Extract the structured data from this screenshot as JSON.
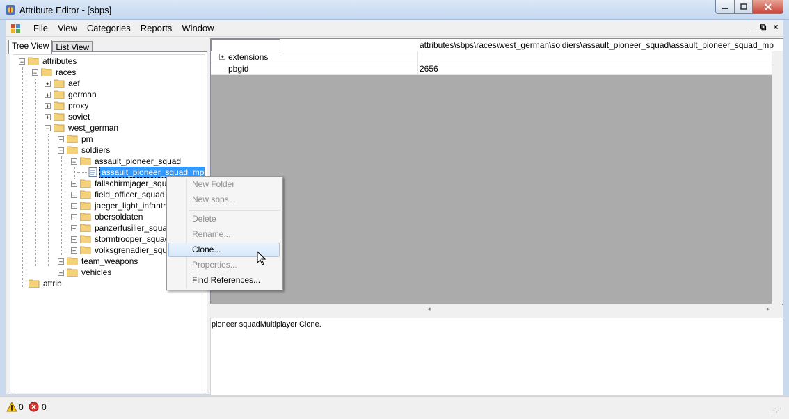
{
  "window": {
    "title": "Attribute Editor - [sbps]"
  },
  "menu": {
    "items": [
      "File",
      "View",
      "Categories",
      "Reports",
      "Window"
    ],
    "mdi_min": "_",
    "mdi_restore": "⧉",
    "mdi_close": "×"
  },
  "tabs": {
    "tree_view": "Tree View",
    "list_view": "List View"
  },
  "tree": {
    "attributes": "attributes",
    "races": "races",
    "aef": "aef",
    "german": "german",
    "proxy": "proxy",
    "soviet": "soviet",
    "west_german": "west_german",
    "pm": "pm",
    "soldiers": "soldiers",
    "assault_pioneer_squad": "assault_pioneer_squad",
    "assault_pioneer_squad_mp": "assault_pioneer_squad_mp",
    "fallschirmjager_squad": "fallschirmjager_squad",
    "field_officer_squad": "field_officer_squad",
    "jaeger_light_infantry_squad": "jaeger_light_infantry_s",
    "obersoldaten": "obersoldaten",
    "panzerfusilier_squad": "panzerfusilier_squad",
    "stormtrooper_squad": "stormtrooper_squad",
    "volksgrenadier_squad": "volksgrenadier_squad",
    "team_weapons": "team_weapons",
    "vehicles": "vehicles",
    "attrib": "attrib"
  },
  "grid": {
    "path": "attributes\\sbps\\races\\west_german\\soldiers\\assault_pioneer_squad\\assault_pioneer_squad_mp",
    "rows": [
      {
        "name": "extensions",
        "value": ""
      },
      {
        "name": "pbgid",
        "value": "2656"
      }
    ],
    "scroll_left": "◂",
    "scroll_right": "▸"
  },
  "description": "pioneer squadMultiplayer Clone.",
  "context_menu": {
    "new_folder": "New Folder",
    "new_sbps": "New sbps...",
    "delete": "Delete",
    "rename": "Rename...",
    "clone": "Clone...",
    "properties": "Properties...",
    "find_references": "Find References..."
  },
  "status": {
    "warnings": "0",
    "errors": "0"
  },
  "colors": {
    "selection": "#3399ff",
    "grid_bg": "#ababab",
    "folder": "#f4d27a"
  }
}
